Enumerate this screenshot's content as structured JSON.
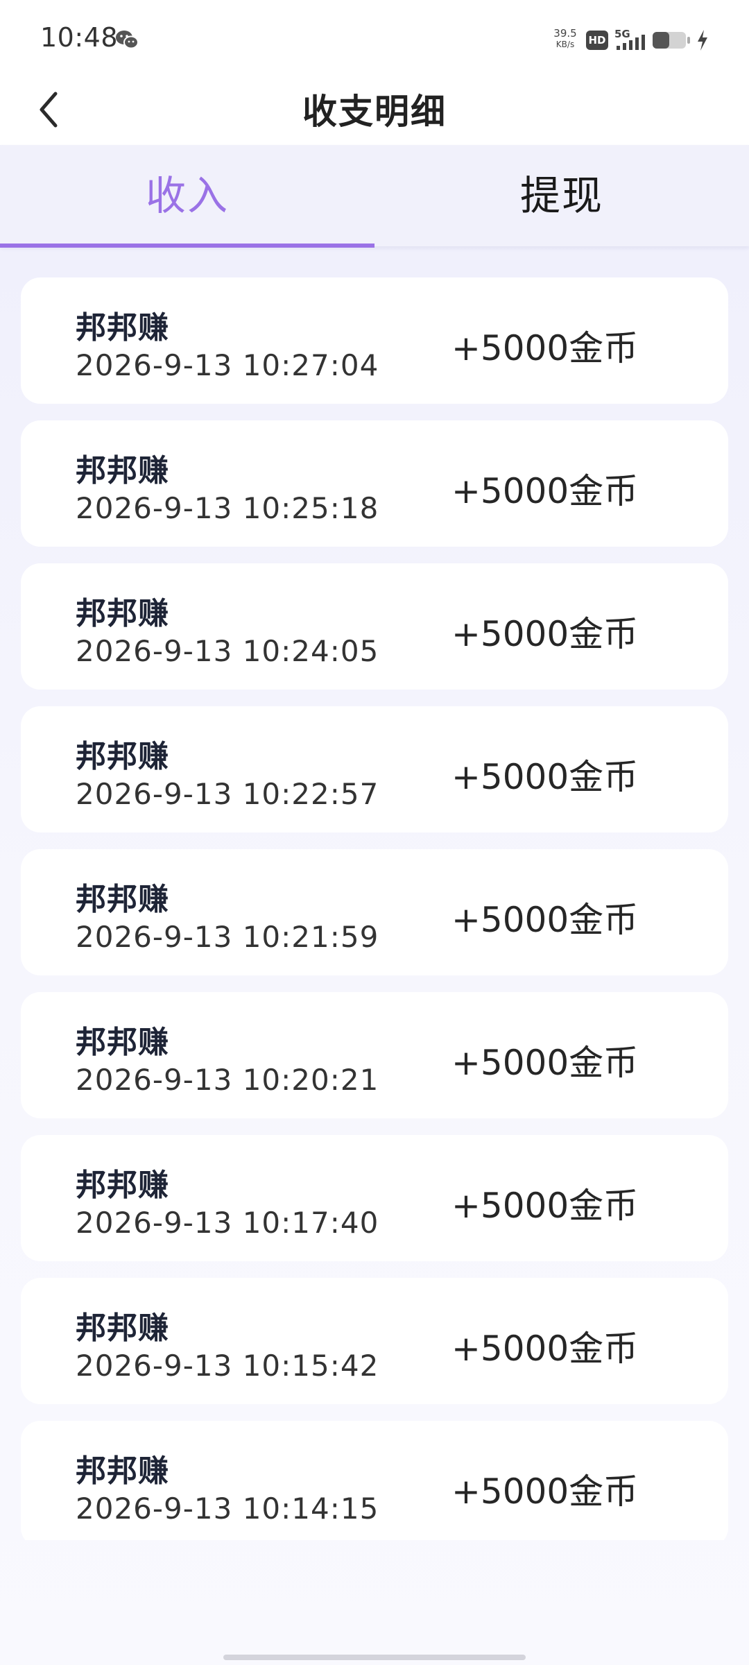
{
  "status_bar": {
    "time": "10:48",
    "net_speed_value": "39.5",
    "net_speed_unit": "KB/s",
    "hd_label": "HD",
    "network_label": "5G",
    "icons": [
      "wechat-icon",
      "hd-icon",
      "signal-5g-icon",
      "battery-icon",
      "charging-icon"
    ]
  },
  "header": {
    "title": "收支明细",
    "back_icon": "chevron-left-icon"
  },
  "tabs": [
    {
      "label": "收入",
      "active": true
    },
    {
      "label": "提现",
      "active": false
    }
  ],
  "colors": {
    "accent": "#9a72e6",
    "card_background": "#ffffff",
    "page_background": "#f1f1fb"
  },
  "records": [
    {
      "source": "邦邦赚",
      "time": "2026-9-13 10:27:04",
      "amount": "+5000金币"
    },
    {
      "source": "邦邦赚",
      "time": "2026-9-13 10:25:18",
      "amount": "+5000金币"
    },
    {
      "source": "邦邦赚",
      "time": "2026-9-13 10:24:05",
      "amount": "+5000金币"
    },
    {
      "source": "邦邦赚",
      "time": "2026-9-13 10:22:57",
      "amount": "+5000金币"
    },
    {
      "source": "邦邦赚",
      "time": "2026-9-13 10:21:59",
      "amount": "+5000金币"
    },
    {
      "source": "邦邦赚",
      "time": "2026-9-13 10:20:21",
      "amount": "+5000金币"
    },
    {
      "source": "邦邦赚",
      "time": "2026-9-13 10:17:40",
      "amount": "+5000金币"
    },
    {
      "source": "邦邦赚",
      "time": "2026-9-13 10:15:42",
      "amount": "+5000金币"
    },
    {
      "source": "邦邦赚",
      "time": "2026-9-13 10:14:15",
      "amount": "+5000金币"
    }
  ]
}
